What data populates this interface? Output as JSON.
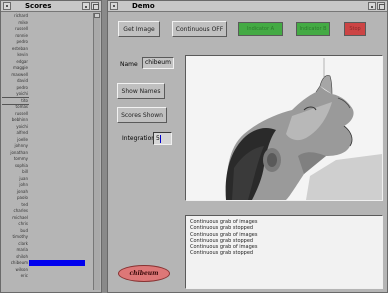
{
  "scores_window": {
    "title": "Scores",
    "names": [
      "richard",
      "mike",
      "russell",
      "ronnie",
      "pedro",
      "esteban",
      "kevin",
      "edgar",
      "maggie",
      "maxwell",
      "david",
      "pedro",
      "yoichi",
      "tito",
      "tomas",
      "russell",
      "bebhinn",
      "yoichi",
      "alfred",
      "joelle",
      "johnny",
      "jonathan",
      "tommy",
      "sophia",
      "bill",
      "juan",
      "john",
      "jonah",
      "paolo",
      "ted",
      "charles",
      "michael",
      "chris",
      "bud",
      "timothy",
      "clark",
      "maria",
      "shiloh",
      "chibeum",
      "wilson",
      "eric"
    ],
    "highlighted_index": 38,
    "boxed_index": 13
  },
  "demo_window": {
    "title": "Demo",
    "buttons": {
      "get_image": "Get Image",
      "continuous": "Continuous OFF",
      "show_names": "Show Names",
      "scores_shown": "Scores Shown"
    },
    "indicators": {
      "green1": "Indicator A",
      "green2": "Indicator B",
      "red": "Stop"
    },
    "name_label": "Name",
    "name_value": "chibeum",
    "integration_label": "Integration",
    "integration_value": "5",
    "log_lines": [
      "Continuous grab of images",
      "Continuous grab stopped",
      "Continuous grab of images",
      "Continuous grab stopped",
      "Continuous grab of images",
      "Continuous grab stopped"
    ],
    "result_name": "chibeum"
  },
  "colors": {
    "highlight": "#0000ee",
    "green_led": "#44aa44",
    "red_led": "#cc4444",
    "name_oval": "#dd7777"
  }
}
